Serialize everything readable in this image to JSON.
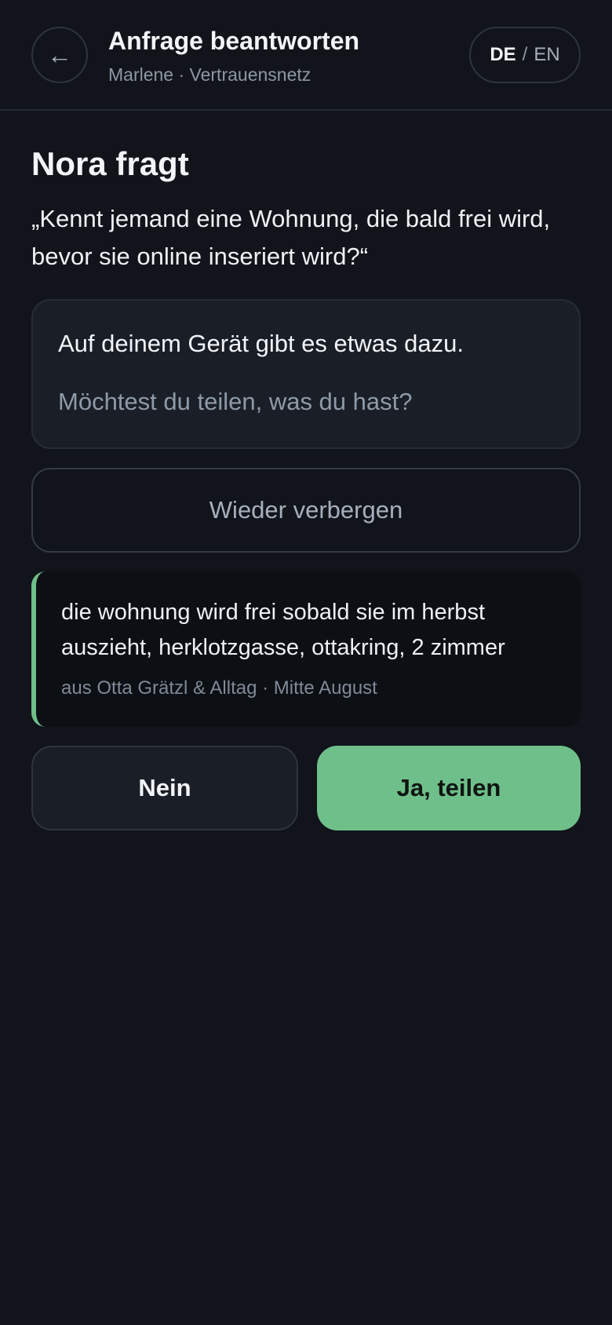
{
  "header": {
    "back_icon": "←",
    "title": "Anfrage beantworten",
    "subtitle": "Marlene · Vertrauensnetz",
    "lang": {
      "active": "DE",
      "separator": "/",
      "inactive": "EN"
    }
  },
  "request": {
    "asker": "Nora fragt",
    "question": "„Kennt jemand eine Wohnung, die bald frei wird, bevor sie online inseriert wird?“"
  },
  "info": {
    "line1": "Auf deinem Gerät gibt es etwas dazu.",
    "line2": "Möchtest du teilen, was du hast?"
  },
  "hide_button": "Wieder verbergen",
  "snippet": {
    "text": "die wohnung wird frei sobald sie im herbst auszieht, herklotzgasse, ottakring, 2 zimmer",
    "meta": "aus Otta Grätzl & Alltag · Mitte August"
  },
  "actions": {
    "no": "Nein",
    "yes": "Ja, teilen"
  },
  "colors": {
    "background": "#11141a",
    "accent": "#6fbf8a"
  }
}
